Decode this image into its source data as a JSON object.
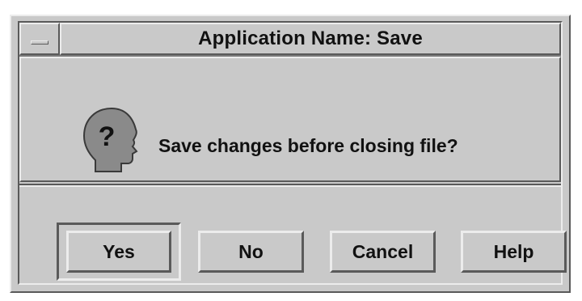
{
  "dialog": {
    "title": "Application Name: Save",
    "message": "Save changes before closing file?",
    "icon": "question-head-icon",
    "buttons": {
      "yes": "Yes",
      "no": "No",
      "cancel": "Cancel",
      "help": "Help"
    },
    "default_button": "yes"
  },
  "colors": {
    "background": "#c9c9c9",
    "highlight": "#ececec",
    "shadow": "#5a5a5a",
    "text": "#111111",
    "icon_fill": "#8a8a8a"
  }
}
